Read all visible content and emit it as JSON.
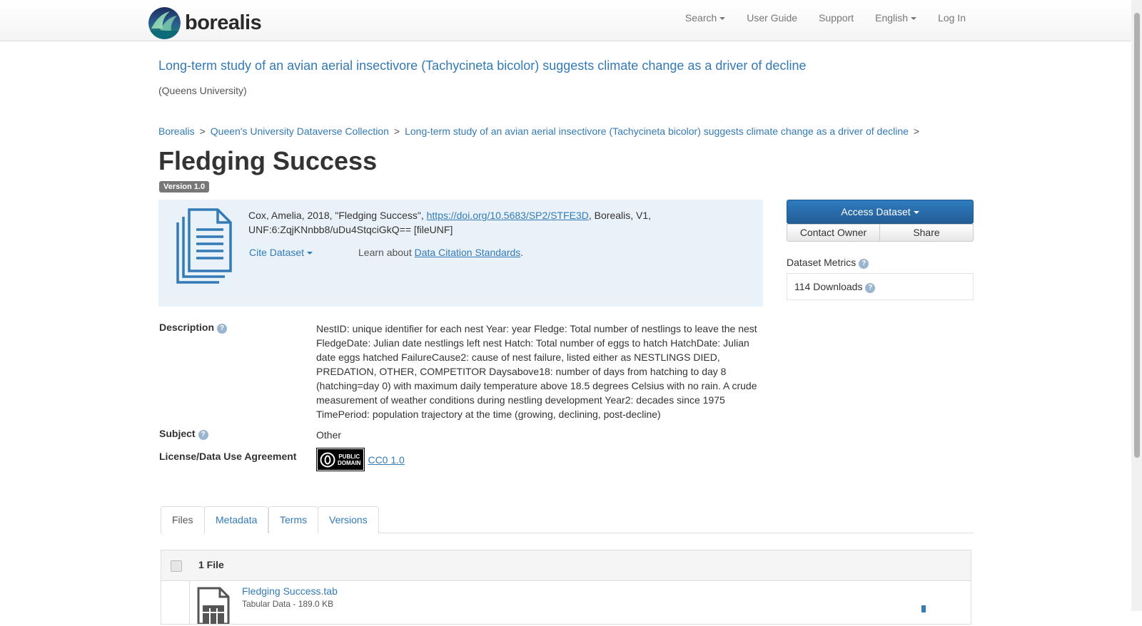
{
  "navbar": {
    "brand": "borealis",
    "items": [
      {
        "label": "Search",
        "dropdown": true
      },
      {
        "label": "User Guide",
        "dropdown": false
      },
      {
        "label": "Support",
        "dropdown": false
      },
      {
        "label": "English",
        "dropdown": true
      },
      {
        "label": "Log In",
        "dropdown": false
      }
    ]
  },
  "parent": {
    "title": "Long-term study of an avian aerial insectivore (Tachycineta bicolor) suggests climate change as a driver of decline",
    "affiliation": "(Queens University)"
  },
  "breadcrumb": [
    "Borealis",
    "Queen's University Dataverse Collection",
    "Long-term study of an avian aerial insectivore (Tachycineta bicolor) suggests climate change as a driver of decline"
  ],
  "breadcrumb_sep": ">",
  "file": {
    "title": "Fledging Success",
    "version": "Version 1.0"
  },
  "citation": {
    "prefix": "Cox, Amelia, 2018, \"Fledging Success\", ",
    "doi": "https://doi.org/10.5683/SP2/STFE3D",
    "suffix": ", Borealis, V1, UNF:6:ZqjKNnbb8/uDu4StqciGkQ== [fileUNF]",
    "cite_dataset": "Cite Dataset",
    "learn_prefix": "Learn about ",
    "learn_link": "Data Citation Standards",
    "learn_suffix": "."
  },
  "sidebar": {
    "access_button": "Access Dataset",
    "contact_owner": "Contact Owner",
    "share": "Share",
    "metrics_title": "Dataset Metrics",
    "downloads": "114 Downloads"
  },
  "metadata": {
    "description_label": "Description",
    "description": "NestID: unique identifier for each nest Year: year Fledge: Total number of nestlings to leave the nest FledgeDate: Julian date nestlings left nest Hatch: Total number of eggs to hatch HatchDate: Julian date eggs hatched FailureCause2: cause of nest failure, listed either as NESTLINGS DIED, PREDATION, OTHER, COMPETITOR Daysabove18: number of days from hatching to day 8 (hatching=day 0) with maximum daily temperature above 18.5 degrees Celsius with no rain. A crude measurement of weather conditions during nestling development Year2: decades since 1975 TimePeriod: population trajectory at the time (growing, declining, post-decline)",
    "subject_label": "Subject",
    "subject": "Other",
    "license_label": "License/Data Use Agreement",
    "license_badge_line1": "PUBLIC",
    "license_badge_line2": "DOMAIN",
    "license_link": "CC0 1.0"
  },
  "tabs": [
    "Files",
    "Metadata",
    "Terms",
    "Versions"
  ],
  "files": {
    "count_label": "1 File",
    "items": [
      {
        "name": "Fledging Success.tab",
        "meta": "Tabular Data - 189.0 KB"
      }
    ]
  },
  "colors": {
    "link": "#337ab7",
    "citation_bg": "#e9f2f9",
    "primary_button": "#2a6ead",
    "version_badge": "#777777"
  }
}
